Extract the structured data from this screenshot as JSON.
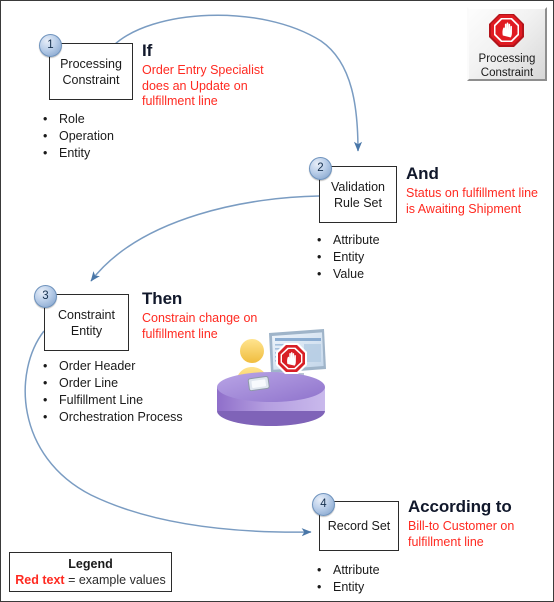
{
  "page": {
    "title": "Processing Constraint rule structure diagram",
    "background_color": "#ffffff",
    "border_color": "#3a3a3a",
    "accent_red": "#ff2a21",
    "arrow_color": "#5b83b0",
    "heading_color": "#11182b"
  },
  "badge": {
    "icon": "stop-hand-octagon-icon",
    "line1": "Processing",
    "line2": "Constraint"
  },
  "steps": [
    {
      "number": "1",
      "box_line1": "Processing",
      "box_line2": "Constraint",
      "bullets": [
        "Role",
        "Operation",
        "Entity"
      ],
      "heading": "If",
      "example_lines": [
        "Order Entry Specialist",
        "does an Update on",
        "fulfillment line"
      ]
    },
    {
      "number": "2",
      "box_line1": "Validation",
      "box_line2": "Rule Set",
      "bullets": [
        "Attribute",
        "Entity",
        "Value"
      ],
      "heading": "And",
      "example_lines": [
        "Status on fulfillment line",
        "is Awaiting Shipment"
      ]
    },
    {
      "number": "3",
      "box_line1": "Constraint",
      "box_line2": "Entity",
      "bullets": [
        "Order Header",
        "Order Line",
        "Fulfillment Line",
        "Orchestration Process"
      ],
      "heading": "Then",
      "example_lines": [
        "Constrain change on",
        "fulfillment line"
      ]
    },
    {
      "number": "4",
      "box_line1": "Record Set",
      "box_line2": "",
      "bullets": [
        "Attribute",
        "Entity"
      ],
      "heading": "According to",
      "example_lines": [
        "Bill-to Customer on",
        "fulfillment line"
      ]
    }
  ],
  "illustration": {
    "name": "user-at-desk-with-blocked-screen-illustration",
    "desk_color": "#a98fd6",
    "person_color": "#f7cf62",
    "stop_color": "#e02020"
  },
  "bullet_glyph": "•",
  "legend": {
    "title": "Legend",
    "red_text": "Red text",
    "rest_text": " = example values"
  }
}
